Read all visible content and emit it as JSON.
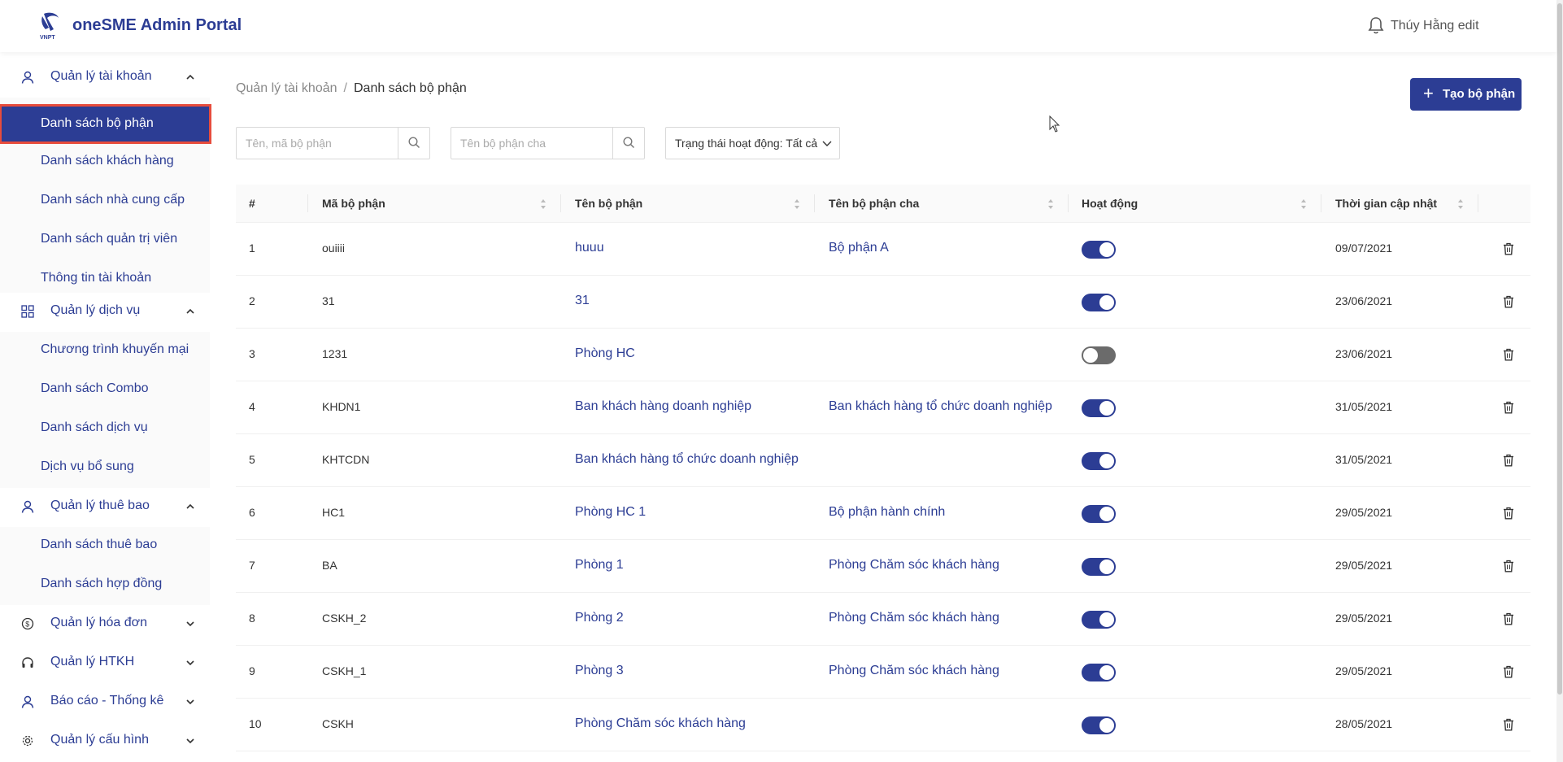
{
  "header": {
    "app_title": "oneSME Admin Portal",
    "logo_text": "VNPT",
    "user_name": "Thúy Hằng edit"
  },
  "sidebar": {
    "groups": [
      {
        "label": "Quản lý tài khoản",
        "icon": "user-icon",
        "expanded": true,
        "items": [
          "Danh sách bộ phận",
          "Danh sách khách hàng",
          "Danh sách nhà cung cấp",
          "Danh sách quản trị viên",
          "Thông tin tài khoản"
        ]
      },
      {
        "label": "Quản lý dịch vụ",
        "icon": "grid-icon",
        "expanded": true,
        "items": [
          "Chương trình khuyến mại",
          "Danh sách Combo",
          "Danh sách dịch vụ",
          "Dịch vụ bổ sung"
        ]
      },
      {
        "label": "Quản lý thuê bao",
        "icon": "user-icon",
        "expanded": true,
        "items": [
          "Danh sách thuê bao",
          "Danh sách hợp đồng"
        ]
      },
      {
        "label": "Quản lý hóa đơn",
        "icon": "dollar-icon",
        "expanded": false,
        "items": []
      },
      {
        "label": "Quản lý HTKH",
        "icon": "headset-icon",
        "expanded": false,
        "items": []
      },
      {
        "label": "Báo cáo - Thống kê",
        "icon": "user-icon",
        "expanded": false,
        "items": []
      },
      {
        "label": "Quản lý cấu hình",
        "icon": "gear-icon",
        "expanded": false,
        "items": []
      }
    ],
    "active_item": "Danh sách bộ phận"
  },
  "breadcrumb": {
    "parent": "Quản lý tài khoản",
    "separator": "/",
    "current": "Danh sách bộ phận"
  },
  "actions": {
    "create_label": "Tạo bộ phận"
  },
  "filters": {
    "search_name_placeholder": "Tên, mã bộ phận",
    "search_parent_placeholder": "Tên bộ phận cha",
    "status_select": "Trạng thái hoạt động: Tất cả"
  },
  "table": {
    "columns": [
      "#",
      "Mã bộ phận",
      "Tên bộ phận",
      "Tên bộ phận cha",
      "Hoạt động",
      "Thời gian cập nhật"
    ],
    "rows": [
      {
        "index": "1",
        "code": "ouiiii",
        "name": "huuu",
        "parent": "Bộ phận A",
        "active": true,
        "updated": "09/07/2021"
      },
      {
        "index": "2",
        "code": "31",
        "name": "31",
        "parent": "",
        "active": true,
        "updated": "23/06/2021"
      },
      {
        "index": "3",
        "code": "1231",
        "name": "Phòng HC",
        "parent": "",
        "active": false,
        "updated": "23/06/2021"
      },
      {
        "index": "4",
        "code": "KHDN1",
        "name": "Ban khách hàng doanh nghiệp",
        "parent": "Ban khách hàng tổ chức doanh nghiệp",
        "active": true,
        "updated": "31/05/2021"
      },
      {
        "index": "5",
        "code": "KHTCDN",
        "name": "Ban khách hàng tổ chức doanh nghiệp",
        "parent": "",
        "active": true,
        "updated": "31/05/2021"
      },
      {
        "index": "6",
        "code": "HC1",
        "name": "Phòng HC 1",
        "parent": "Bộ phận hành chính",
        "active": true,
        "updated": "29/05/2021"
      },
      {
        "index": "7",
        "code": "BA",
        "name": "Phòng 1",
        "parent": "Phòng Chăm sóc khách hàng",
        "active": true,
        "updated": "29/05/2021"
      },
      {
        "index": "8",
        "code": "CSKH_2",
        "name": "Phòng 2",
        "parent": "Phòng Chăm sóc khách hàng",
        "active": true,
        "updated": "29/05/2021"
      },
      {
        "index": "9",
        "code": "CSKH_1",
        "name": "Phòng 3",
        "parent": "Phòng Chăm sóc khách hàng",
        "active": true,
        "updated": "29/05/2021"
      },
      {
        "index": "10",
        "code": "CSKH",
        "name": "Phòng Chăm sóc khách hàng",
        "parent": "",
        "active": true,
        "updated": "28/05/2021"
      }
    ]
  },
  "colors": {
    "brand": "#2c3d94",
    "highlight_outline": "#e74c3c",
    "toggle_off": "#6b6b6b"
  }
}
